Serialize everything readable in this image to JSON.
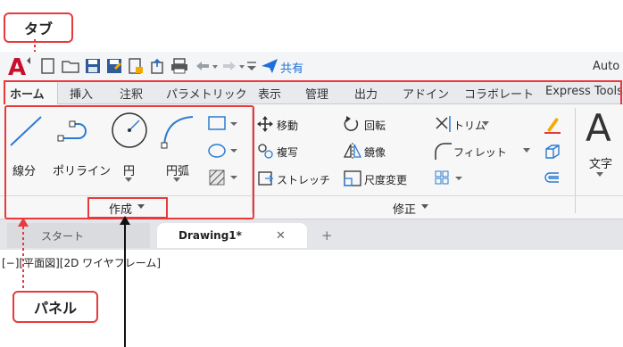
{
  "callouts": {
    "tab_label": "タブ",
    "panel_label": "パネル"
  },
  "app": {
    "title_partial": "Auto",
    "share_label": "共有"
  },
  "ribbon_tabs": [
    {
      "label": "ホーム"
    },
    {
      "label": "挿入"
    },
    {
      "label": "注釈"
    },
    {
      "label": "パラメトリック"
    },
    {
      "label": "表示"
    },
    {
      "label": "管理"
    },
    {
      "label": "出力"
    },
    {
      "label": "アドイン"
    },
    {
      "label": "コラボレート"
    },
    {
      "label": "Express Tools"
    }
  ],
  "draw_panel": {
    "line": "線分",
    "polyline": "ポリライン",
    "circle": "円",
    "arc": "円弧",
    "panel_title": "作成"
  },
  "modify_panel": {
    "move": "移動",
    "rotate": "回転",
    "trim": "トリム",
    "copy": "複写",
    "mirror": "鏡像",
    "fillet": "フィレット",
    "stretch": "ストレッチ",
    "scale": "尺度変更",
    "panel_title": "修正"
  },
  "text_tool": {
    "label": "文字",
    "glyph": "A"
  },
  "doc_tabs": {
    "start": "スタート",
    "drawing": "Drawing1*",
    "close": "✕",
    "add": "+"
  },
  "viewport": {
    "label": "[−][平面図][2D ワイヤフレーム]"
  },
  "colors": {
    "accent_red": "#e8393d",
    "autocad_red": "#c8102e",
    "share_blue": "#1e6fd9"
  }
}
